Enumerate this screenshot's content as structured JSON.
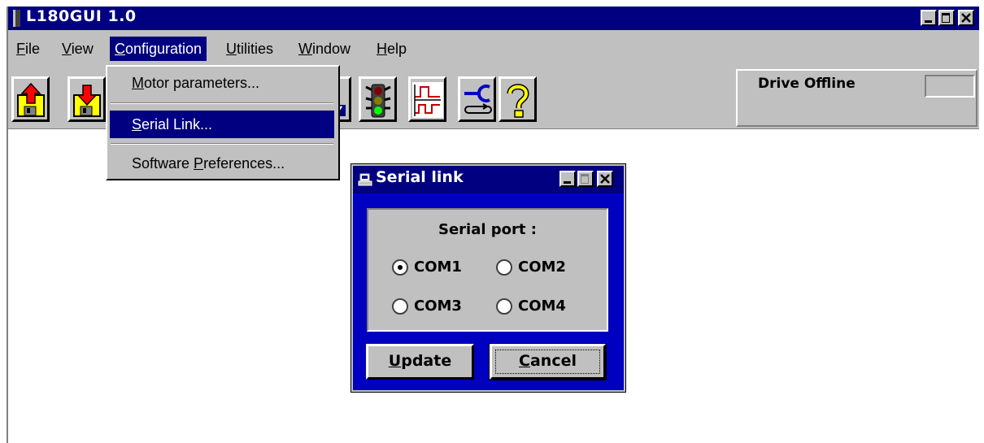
{
  "window": {
    "title": "L180GUI   1.0"
  },
  "menubar": {
    "items": [
      {
        "label": "File",
        "mnemonic": "F",
        "rest": "ile"
      },
      {
        "label": "View",
        "mnemonic": "V",
        "rest": "iew"
      },
      {
        "label": "Configuration",
        "mnemonic": "C",
        "rest": "onfiguration"
      },
      {
        "label": "Utilities",
        "mnemonic": "U",
        "rest": "tilities"
      },
      {
        "label": "Window",
        "mnemonic": "W",
        "rest": "indow"
      },
      {
        "label": "Help",
        "mnemonic": "H",
        "rest": "elp"
      }
    ],
    "active": "Configuration"
  },
  "dropdown": {
    "items": [
      {
        "label": "Motor parameters...",
        "pre": "",
        "mnemonic": "M",
        "rest": "otor parameters..."
      },
      {
        "label": "Serial Link...",
        "pre": "",
        "mnemonic": "S",
        "rest": "erial Link..."
      },
      {
        "label": "Software Preferences...",
        "pre": "Software ",
        "mnemonic": "P",
        "rest": "references..."
      }
    ],
    "highlighted": "Serial Link..."
  },
  "toolbar": {
    "buttons": [
      "upload-icon",
      "download-icon",
      "settings-icon",
      "traffic-light-icon",
      "signal-timing-icon",
      "loop-connect-icon",
      "help-icon"
    ]
  },
  "status": {
    "text": "Drive Offline",
    "led_color": "#c0c0c0"
  },
  "dialog": {
    "title": "Serial link",
    "group_label": "Serial port :",
    "options": [
      {
        "label": "COM1",
        "checked": true
      },
      {
        "label": "COM2",
        "checked": false
      },
      {
        "label": "COM3",
        "checked": false
      },
      {
        "label": "COM4",
        "checked": false
      }
    ],
    "update_mnemonic": "U",
    "update_rest": "pdate",
    "cancel_mnemonic": "C",
    "cancel_rest": "ancel"
  },
  "colors": {
    "titlebar": "#000080",
    "dialog_bg": "#0000c0",
    "face": "#c0c0c0",
    "highlight": "#000080"
  }
}
